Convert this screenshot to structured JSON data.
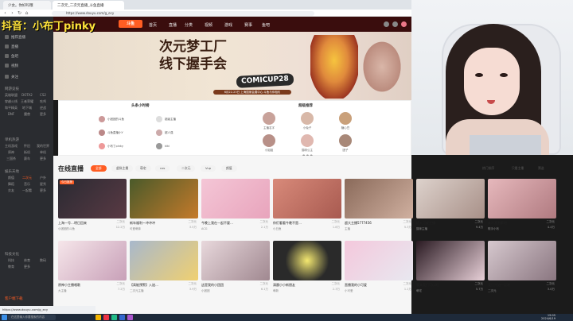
{
  "overlay": {
    "streamer": "抖音：小布丁pinky"
  },
  "browser": {
    "tabs": [
      "少女。你好吗哦",
      "二次元_二次元直播_斗鱼直播",
      "百度一下",
      "更多"
    ],
    "url": "https://www.douyu.com/g_ecy"
  },
  "header": {
    "logo": "斗鱼",
    "nav": [
      "首页",
      "直播",
      "分类",
      "视频",
      "游戏",
      "赛事",
      "鱼吧",
      "娱乐",
      "商城",
      "桃花源",
      "下载"
    ],
    "logo2": "斗鱼"
  },
  "sidebar": {
    "items": [
      "推荐直播",
      "直播",
      "鱼吧",
      "视频",
      "关注"
    ],
    "sections": [
      {
        "head": "网游竞技",
        "cats": [
          "英雄联盟",
          "DOTA2",
          "CS2",
          "穿越火线",
          "王者荣耀",
          "吃鸡",
          "和平精英",
          "地下城",
          "逆战",
          "DNF",
          "魔兽",
          "更多"
        ]
      },
      {
        "head": "单机热游",
        "cats": [
          "主机游戏",
          "怀旧",
          "我的世界",
          "原神",
          "街机",
          "单机",
          "三国杀",
          "赛车",
          "更多"
        ]
      },
      {
        "head": "娱乐天地",
        "cats": [
          "颜值",
          "二次元",
          "户外",
          "舞蹈",
          "音乐",
          "星秀",
          "交友",
          "一起看",
          "更多"
        ]
      },
      {
        "head": "科技文化",
        "cats": [
          "科技",
          "体育",
          "数码",
          "教育",
          "更多"
        ]
      }
    ],
    "bottom": "客户端下载"
  },
  "banner": {
    "line1": "次元梦工厂",
    "line2": "线下握手会",
    "comic": "COMICUP28",
    "date": "6月22-23日 上海国家会展中心 斗鱼与你相约"
  },
  "recommend": {
    "title1": "头条小时榜",
    "title2": "超级推荐",
    "people": [
      {
        "n": "小团团的斗鱼"
      },
      {
        "n": "超级主播"
      },
      {
        "n": "斗鱼直播小Y"
      },
      {
        "n": "超人强"
      },
      {
        "n": "小布丁pinky"
      },
      {
        "n": "kiki"
      }
    ],
    "ups": [
      "主播名字",
      "小兔子",
      "糖心豆",
      "小姐姐",
      "猫咪公主",
      "团子"
    ]
  },
  "live": {
    "title": "在线直播",
    "filters": [
      "全部",
      "虚拟主播",
      "萌宅",
      "cos",
      "二次元",
      "Vup",
      "颜值"
    ],
    "right": [
      "热门排序",
      "只看主播",
      "筛选"
    ],
    "cards": [
      {
        "title": "上海一号…明日回来",
        "author": "小团团的斗鱼",
        "tag": "二次元",
        "views": "12.2万",
        "label": "今日推荐"
      },
      {
        "title": "新年福利～冲冲冲",
        "author": "可爱萌妹",
        "tag": "二次元",
        "views": "3.5万",
        "label": ""
      },
      {
        "title": "今晚上我在一起不要…",
        "author": "ACG",
        "tag": "二次元",
        "views": "2.1万",
        "label": ""
      },
      {
        "title": "你们看看今晚不是…",
        "author": "小丑鱼",
        "tag": "二次元",
        "views": "1.8万",
        "label": ""
      },
      {
        "title": "超大主播5777456",
        "author": "主播",
        "tag": "二次元",
        "views": "5.3万",
        "label": ""
      },
      {
        "title": "进入可爱主播",
        "author": "猫咪主播",
        "tag": "二次元",
        "views": "9.4万",
        "label": ""
      },
      {
        "title": "来听我唱歌吧",
        "author": "歌手小布",
        "tag": "二次元",
        "views": "4.4万",
        "label": ""
      },
      {
        "title": "原神小主播唱歌",
        "author": "大主播",
        "tag": "二次元",
        "views": "7.2万",
        "label": ""
      },
      {
        "title": "【高能预警】入迷…",
        "author": "二次元主播",
        "tag": "二次元",
        "views": "3.9万",
        "label": ""
      },
      {
        "title": "这是我的小团团",
        "author": "小团团",
        "tag": "二次元",
        "views": "6.1万",
        "label": ""
      },
      {
        "title": "清晨小小新朋友",
        "author": "萌新",
        "tag": "二次元",
        "views": "2.3万",
        "label": ""
      },
      {
        "title": "直播我的小可爱",
        "author": "小可爱",
        "tag": "二次元",
        "views": "1.1万",
        "label": ""
      },
      {
        "title": "看来我们可以吗",
        "author": "萌宅",
        "tag": "二次元",
        "views": "5.7万",
        "label": ""
      },
      {
        "title": "我们开始一起吧",
        "author": "二次元",
        "tag": "二次元",
        "views": "3.0万",
        "label": ""
      },
      {
        "title": "好哥哥你好呀",
        "author": "kiki",
        "tag": "二次元",
        "views": "8.8万",
        "label": ""
      }
    ]
  },
  "statusbar": {
    "text": "https://www.douyu.com/g_ecy"
  },
  "taskbar": {
    "search": "在这里输入你要搜索的内容",
    "time": "19:05",
    "date": "2024/6/19"
  },
  "colors": {
    "accent": "#ff5d23",
    "overlay": "#ffe33a",
    "header": "#3a0d0d"
  }
}
